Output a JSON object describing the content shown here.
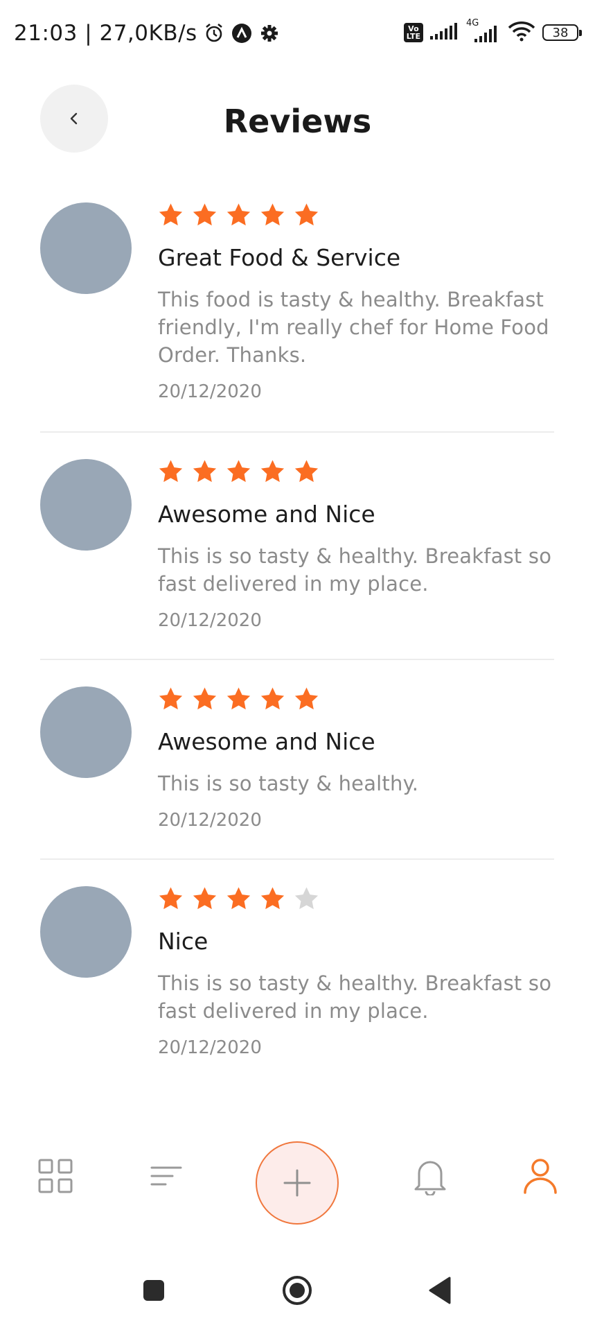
{
  "status_bar": {
    "time": "21:03 | 27,0KB/s",
    "network_badge": "Vo\nLTE",
    "network_4g": "4G",
    "battery": "38",
    "icons": [
      "alarm-icon",
      "app-notification-icon",
      "settings-icon",
      "volte-icon",
      "signal-icon",
      "signal-4g-icon",
      "wifi-icon",
      "battery-icon"
    ]
  },
  "header": {
    "title": "Reviews",
    "back_icon": "chevron-left-icon"
  },
  "colors": {
    "accent": "#f47a2a",
    "star_filled": "#fb6d22",
    "star_empty": "#d6d6d6",
    "avatar": "#99a7b6",
    "muted_text": "#8b8b8b"
  },
  "reviews": [
    {
      "rating": 5,
      "title": "Great Food & Service",
      "text": "This food is tasty & healthy. Breakfast friendly, I'm really chef for Home Food Order. Thanks.",
      "date": "20/12/2020"
    },
    {
      "rating": 5,
      "title": "Awesome and Nice",
      "text": "This is so tasty & healthy. Breakfast so fast delivered in my place.",
      "date": "20/12/2020"
    },
    {
      "rating": 5,
      "title": "Awesome and Nice",
      "text": "This is so tasty & healthy.",
      "date": "20/12/2020"
    },
    {
      "rating": 4,
      "title": "Nice",
      "text": "This is so tasty & healthy. Breakfast so fast delivered in my place.",
      "date": "20/12/2020"
    }
  ],
  "bottom_nav": {
    "items": [
      "grid-icon",
      "list-icon",
      "plus-icon",
      "bell-icon",
      "user-icon"
    ],
    "active": "user-icon"
  },
  "system_nav": {
    "items": [
      "recent-apps-icon",
      "home-icon",
      "back-triangle-icon"
    ]
  }
}
